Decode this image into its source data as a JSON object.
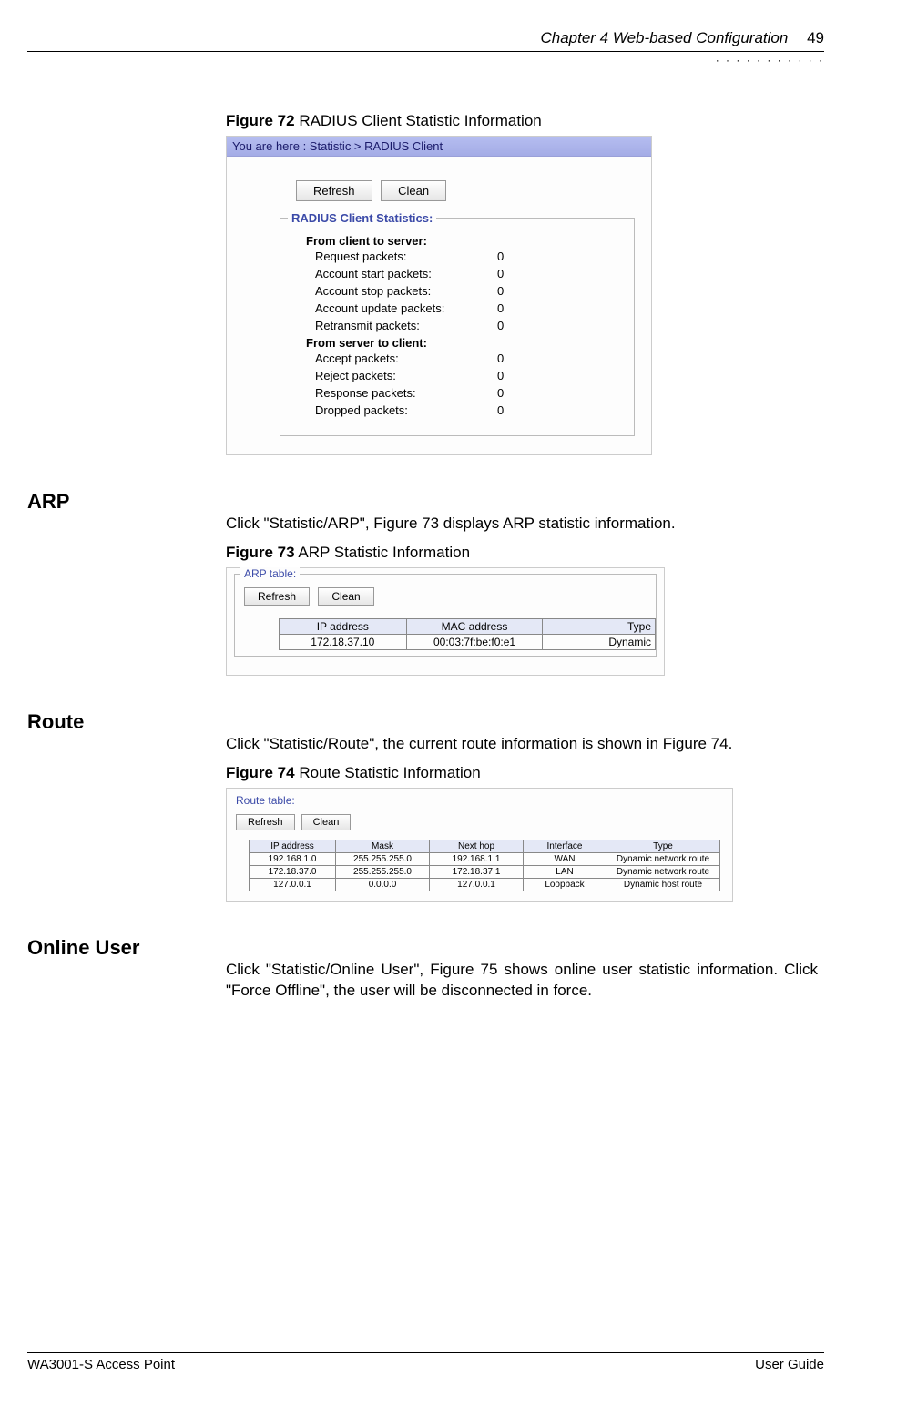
{
  "header": {
    "chapter": "Chapter 4 Web-based Configuration",
    "page_number": "49"
  },
  "fig72": {
    "caption_num": "Figure 72",
    "caption_text": " RADIUS Client Statistic Information",
    "breadcrumb": "You are here : Statistic > RADIUS Client",
    "btn_refresh": "Refresh",
    "btn_clean": "Clean",
    "legend": "RADIUS Client Statistics:",
    "head_c2s": "From client to server:",
    "rows_c2s": [
      {
        "label": "Request packets:",
        "value": "0"
      },
      {
        "label": "Account start packets:",
        "value": "0"
      },
      {
        "label": "Account stop packets:",
        "value": "0"
      },
      {
        "label": "Account update packets:",
        "value": "0"
      },
      {
        "label": "Retransmit packets:",
        "value": "0"
      }
    ],
    "head_s2c": "From server to client:",
    "rows_s2c": [
      {
        "label": "Accept packets:",
        "value": "0"
      },
      {
        "label": "Reject packets:",
        "value": "0"
      },
      {
        "label": "Response packets:",
        "value": "0"
      },
      {
        "label": "Dropped packets:",
        "value": "0"
      }
    ]
  },
  "arp": {
    "heading": "ARP",
    "intro": "Click \"Statistic/ARP\", Figure 73 displays ARP statistic information.",
    "caption_num": "Figure 73",
    "caption_text": " ARP Statistic Information",
    "legend": "ARP table:",
    "btn_refresh": "Refresh",
    "btn_clean": "Clean",
    "cols": {
      "ip": "IP address",
      "mac": "MAC address",
      "type": "Type"
    },
    "row": {
      "ip": "172.18.37.10",
      "mac": "00:03:7f:be:f0:e1",
      "type": "Dynamic"
    }
  },
  "route": {
    "heading": "Route",
    "intro": "Click \"Statistic/Route\", the current route information is shown in Figure 74.",
    "caption_num": "Figure 74",
    "caption_text": " Route Statistic Information",
    "legend": "Route table:",
    "btn_refresh": "Refresh",
    "btn_clean": "Clean",
    "cols": {
      "ip": "IP address",
      "mask": "Mask",
      "nh": "Next hop",
      "if": "Interface",
      "type": "Type"
    },
    "rows": [
      {
        "ip": "192.168.1.0",
        "mask": "255.255.255.0",
        "nh": "192.168.1.1",
        "if": "WAN",
        "type": "Dynamic network route"
      },
      {
        "ip": "172.18.37.0",
        "mask": "255.255.255.0",
        "nh": "172.18.37.1",
        "if": "LAN",
        "type": "Dynamic network route"
      },
      {
        "ip": "127.0.0.1",
        "mask": "0.0.0.0",
        "nh": "127.0.0.1",
        "if": "Loopback",
        "type": "Dynamic host route"
      }
    ]
  },
  "online": {
    "heading": "Online User",
    "text": "Click \"Statistic/Online User\", Figure 75 shows online user statistic information. Click \"Force Offline\", the user will be disconnected in force."
  },
  "footer": {
    "left": "WA3001-S Access Point",
    "right": "User Guide"
  }
}
